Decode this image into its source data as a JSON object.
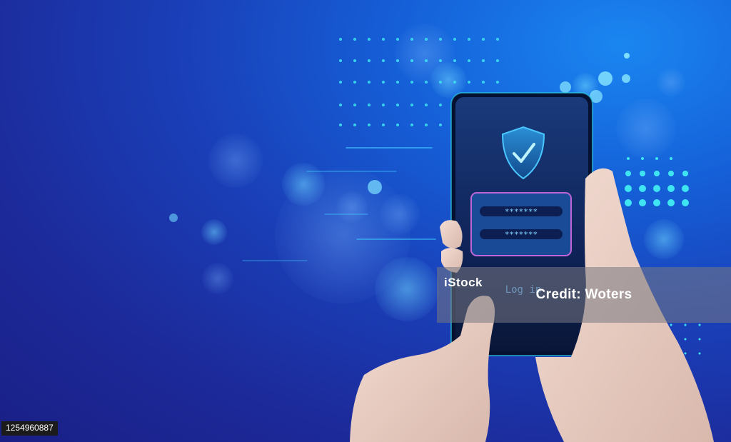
{
  "phone_screen": {
    "password_mask_1": "*******",
    "password_mask_2": "*******",
    "login_label": "Log in",
    "icon": "shield-check-icon"
  },
  "watermark": {
    "prefix": "iStock",
    "credit": "Credit: Woters"
  },
  "stock_id": "1254960887",
  "colors": {
    "background_dark": "#1a1f86",
    "background_light": "#1a86f0",
    "accent_cyan": "#36e0f0",
    "phone_screen": "#0e1e4a"
  }
}
